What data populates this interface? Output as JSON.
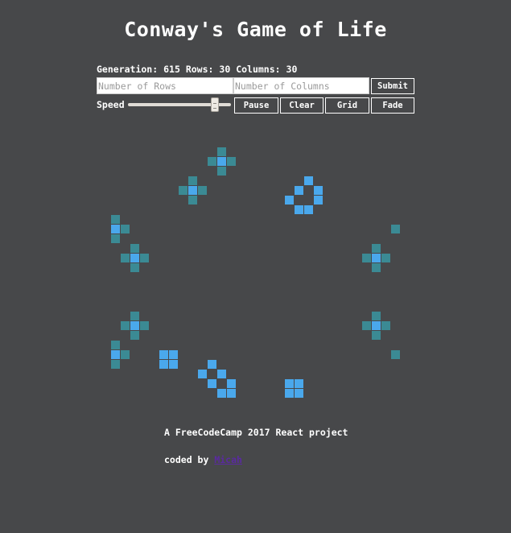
{
  "title": "Conway's Game of Life",
  "stats": {
    "generation_label": "Generation:",
    "generation": "615",
    "rows_label": "Rows:",
    "rows": "30",
    "columns_label": "Columns:",
    "columns": "30"
  },
  "inputs": {
    "rows_placeholder": "Number of Rows",
    "columns_placeholder": "Number of Columns"
  },
  "buttons": {
    "submit": "Submit",
    "pause": "Pause",
    "clear": "Clear",
    "grid": "Grid",
    "fade": "Fade"
  },
  "speed": {
    "label": "Speed",
    "value": 0.87
  },
  "colors": {
    "background": "#47484a",
    "cell_alive": "#4aa8ec",
    "cell_old": "#3b8a94"
  },
  "board": {
    "rows": 30,
    "columns": 30,
    "cells": [
      {
        "r": 2,
        "c": 11,
        "s": "old"
      },
      {
        "r": 3,
        "c": 10,
        "s": "old"
      },
      {
        "r": 3,
        "c": 11,
        "s": "alive"
      },
      {
        "r": 3,
        "c": 12,
        "s": "old"
      },
      {
        "r": 4,
        "c": 11,
        "s": "old"
      },
      {
        "r": 5,
        "c": 8,
        "s": "old"
      },
      {
        "r": 5,
        "c": 20,
        "s": "alive"
      },
      {
        "r": 6,
        "c": 7,
        "s": "old"
      },
      {
        "r": 6,
        "c": 8,
        "s": "alive"
      },
      {
        "r": 6,
        "c": 9,
        "s": "old"
      },
      {
        "r": 6,
        "c": 19,
        "s": "alive"
      },
      {
        "r": 6,
        "c": 21,
        "s": "alive"
      },
      {
        "r": 7,
        "c": 8,
        "s": "old"
      },
      {
        "r": 7,
        "c": 18,
        "s": "alive"
      },
      {
        "r": 7,
        "c": 21,
        "s": "alive"
      },
      {
        "r": 8,
        "c": 19,
        "s": "alive"
      },
      {
        "r": 8,
        "c": 20,
        "s": "alive"
      },
      {
        "r": 9,
        "c": 0,
        "s": "old"
      },
      {
        "r": 10,
        "c": 0,
        "s": "alive"
      },
      {
        "r": 10,
        "c": 1,
        "s": "old"
      },
      {
        "r": 10,
        "c": 29,
        "s": "old"
      },
      {
        "r": 11,
        "c": 0,
        "s": "old"
      },
      {
        "r": 12,
        "c": 2,
        "s": "old"
      },
      {
        "r": 12,
        "c": 27,
        "s": "old"
      },
      {
        "r": 13,
        "c": 2,
        "s": "alive"
      },
      {
        "r": 13,
        "c": 1,
        "s": "old"
      },
      {
        "r": 13,
        "c": 3,
        "s": "old"
      },
      {
        "r": 13,
        "c": 26,
        "s": "old"
      },
      {
        "r": 13,
        "c": 27,
        "s": "alive"
      },
      {
        "r": 13,
        "c": 28,
        "s": "old"
      },
      {
        "r": 14,
        "c": 2,
        "s": "old"
      },
      {
        "r": 14,
        "c": 27,
        "s": "old"
      },
      {
        "r": 19,
        "c": 2,
        "s": "old"
      },
      {
        "r": 19,
        "c": 27,
        "s": "old"
      },
      {
        "r": 20,
        "c": 1,
        "s": "old"
      },
      {
        "r": 20,
        "c": 2,
        "s": "alive"
      },
      {
        "r": 20,
        "c": 3,
        "s": "old"
      },
      {
        "r": 20,
        "c": 26,
        "s": "old"
      },
      {
        "r": 20,
        "c": 27,
        "s": "alive"
      },
      {
        "r": 20,
        "c": 28,
        "s": "old"
      },
      {
        "r": 21,
        "c": 2,
        "s": "old"
      },
      {
        "r": 21,
        "c": 27,
        "s": "old"
      },
      {
        "r": 22,
        "c": 0,
        "s": "old"
      },
      {
        "r": 23,
        "c": 0,
        "s": "alive"
      },
      {
        "r": 23,
        "c": 1,
        "s": "old"
      },
      {
        "r": 23,
        "c": 5,
        "s": "alive"
      },
      {
        "r": 23,
        "c": 6,
        "s": "alive"
      },
      {
        "r": 23,
        "c": 29,
        "s": "old"
      },
      {
        "r": 24,
        "c": 0,
        "s": "old"
      },
      {
        "r": 24,
        "c": 5,
        "s": "alive"
      },
      {
        "r": 24,
        "c": 6,
        "s": "alive"
      },
      {
        "r": 24,
        "c": 10,
        "s": "alive"
      },
      {
        "r": 25,
        "c": 9,
        "s": "alive"
      },
      {
        "r": 25,
        "c": 11,
        "s": "alive"
      },
      {
        "r": 26,
        "c": 10,
        "s": "alive"
      },
      {
        "r": 26,
        "c": 12,
        "s": "alive"
      },
      {
        "r": 26,
        "c": 18,
        "s": "alive"
      },
      {
        "r": 26,
        "c": 19,
        "s": "alive"
      },
      {
        "r": 27,
        "c": 11,
        "s": "alive"
      },
      {
        "r": 27,
        "c": 12,
        "s": "alive"
      },
      {
        "r": 27,
        "c": 18,
        "s": "alive"
      },
      {
        "r": 27,
        "c": 19,
        "s": "alive"
      }
    ]
  },
  "footer": {
    "credit": "A FreeCodeCamp 2017 React project",
    "coded_by": "coded by",
    "author": "Micah"
  }
}
